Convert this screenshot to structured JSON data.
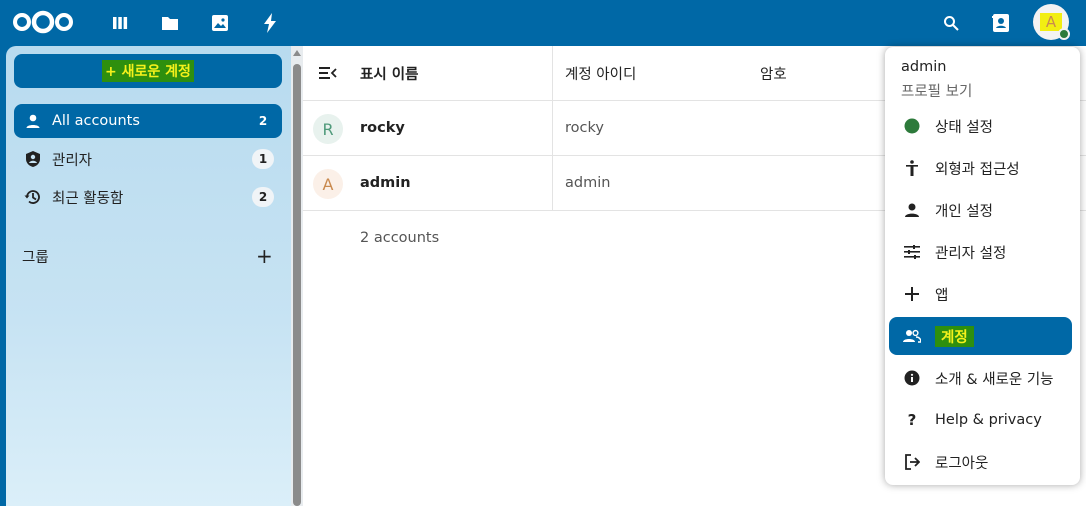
{
  "topbar": {
    "logo": "nextcloud-logo",
    "apps": [
      "dashboard-icon",
      "files-icon",
      "photos-icon",
      "activity-icon"
    ],
    "right": [
      "search-icon",
      "contacts-icon"
    ],
    "avatar_letter": "A",
    "status_color": "#2d7a3b"
  },
  "sidebar": {
    "new_account": "+ 새로운 계정",
    "items": [
      {
        "label": "All accounts",
        "count": "2",
        "icon": "user-icon"
      },
      {
        "label": "관리자",
        "count": "1",
        "icon": "shield-user-icon"
      },
      {
        "label": "최근 활동함",
        "count": "2",
        "icon": "history-icon"
      }
    ],
    "groups_label": "그룹",
    "add_group": "+"
  },
  "table": {
    "headers": [
      "표시 이름",
      "계정 아이디",
      "암호"
    ],
    "rows": [
      {
        "avatar": "R",
        "name": "rocky",
        "id": "rocky"
      },
      {
        "avatar": "A",
        "name": "admin",
        "id": "admin"
      }
    ],
    "footer": "2 accounts"
  },
  "menu": {
    "user": "admin",
    "profile": "프로필 보기",
    "items": [
      {
        "label": "상태 설정",
        "icon": "status-dot-icon"
      },
      {
        "label": "외형과 접근성",
        "icon": "accessibility-icon"
      },
      {
        "label": "개인 설정",
        "icon": "person-icon"
      },
      {
        "label": "관리자 설정",
        "icon": "sliders-icon"
      },
      {
        "label": "앱",
        "icon": "plus-icon"
      },
      {
        "label": "계정",
        "icon": "accounts-icon"
      },
      {
        "label": "소개 & 새로운 기능",
        "icon": "info-icon"
      },
      {
        "label": "Help & privacy",
        "icon": "question-icon"
      },
      {
        "label": "로그아웃",
        "icon": "logout-icon"
      }
    ]
  },
  "colors": {
    "primary": "#0068a6",
    "highlight_bg": "#2e8f0e",
    "highlight_fg": "#f5f11b"
  }
}
